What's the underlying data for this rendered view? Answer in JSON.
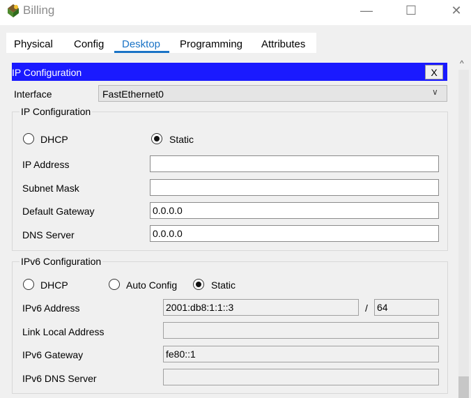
{
  "window": {
    "title": "Billing",
    "minimize_glyph": "—",
    "maximize_glyph": "☐",
    "close_glyph": "✕"
  },
  "tabs": [
    {
      "label": "Physical"
    },
    {
      "label": "Config"
    },
    {
      "label": "Desktop",
      "active": true
    },
    {
      "label": "Programming"
    },
    {
      "label": "Attributes"
    }
  ],
  "ip_config": {
    "header": "IP Configuration",
    "close_label": "X",
    "interface_label": "Interface",
    "interface_value": "FastEthernet0",
    "ipv4": {
      "group_title": "IP Configuration",
      "dhcp_label": "DHCP",
      "static_label": "Static",
      "mode": "static",
      "fields": {
        "ip_address": {
          "label": "IP Address",
          "value": ""
        },
        "subnet_mask": {
          "label": "Subnet Mask",
          "value": ""
        },
        "default_gateway": {
          "label": "Default Gateway",
          "value": "0.0.0.0"
        },
        "dns_server": {
          "label": "DNS Server",
          "value": "0.0.0.0"
        }
      }
    },
    "ipv6": {
      "group_title": "IPv6 Configuration",
      "dhcp_label": "DHCP",
      "auto_label": "Auto Config",
      "static_label": "Static",
      "mode": "static",
      "fields": {
        "address": {
          "label": "IPv6 Address",
          "value": "2001:db8:1:1::3",
          "separator": "/",
          "prefix": "64"
        },
        "link_local": {
          "label": "Link Local Address",
          "value": ""
        },
        "gateway": {
          "label": "IPv6 Gateway",
          "value": "fe80::1"
        },
        "dns_server": {
          "label": "IPv6 DNS Server",
          "value": ""
        }
      }
    }
  },
  "colors": {
    "accent": "#1a73c6",
    "header_blue": "#1a1aff"
  }
}
